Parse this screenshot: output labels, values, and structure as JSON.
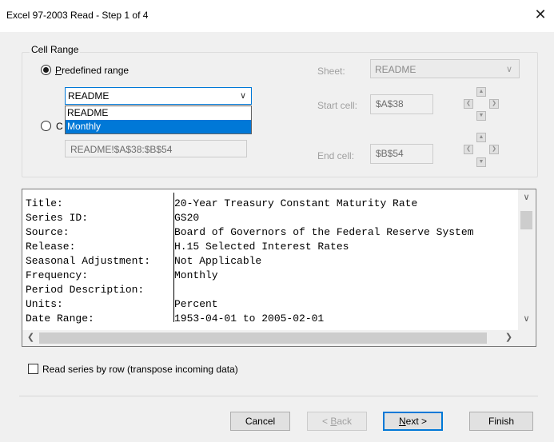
{
  "window": {
    "title": "Excel 97-2003 Read - Step 1 of 4",
    "close_glyph": "✕"
  },
  "cell_range": {
    "legend": "Cell Range",
    "predefined_label_prefix": "",
    "predefined_label_mnemonic": "P",
    "predefined_label_rest": "redefined range",
    "predefined_selected": "README",
    "dropdown_options": [
      "README",
      "Monthly"
    ],
    "custom_label_partial": "C",
    "custom_range_value": "README!$A$38:$B$54",
    "sheet_label": "Sheet:",
    "sheet_value": "README",
    "start_label": "Start cell:",
    "start_value": "$A$38",
    "end_label": "End cell:",
    "end_value": "$B$54"
  },
  "preview": {
    "rows": [
      {
        "key": "Title:",
        "value": "20-Year Treasury Constant Maturity Rate"
      },
      {
        "key": "Series ID:",
        "value": "GS20"
      },
      {
        "key": "Source:",
        "value": "Board of Governors of the Federal Reserve System"
      },
      {
        "key": "Release:",
        "value": "H.15 Selected Interest Rates"
      },
      {
        "key": "Seasonal Adjustment:",
        "value": "Not Applicable"
      },
      {
        "key": "Frequency:",
        "value": "Monthly"
      },
      {
        "key": "Period Description:",
        "value": ""
      },
      {
        "key": "Units:",
        "value": "Percent"
      },
      {
        "key": "Date Range:",
        "value": "1953-04-01 to 2005-02-01"
      }
    ]
  },
  "options": {
    "transpose_label": "Read series by row (transpose incoming data)",
    "transpose_checked": false
  },
  "buttons": {
    "cancel": "Cancel",
    "back_prefix": "< ",
    "back_mnemonic": "B",
    "back_rest": "ack",
    "next_mnemonic": "N",
    "next_rest": "ext >",
    "finish": "Finish"
  },
  "icons": {
    "chevron": "∨",
    "scroll_up": "▲",
    "scroll_down": "▼",
    "scroll_left": "❮",
    "scroll_right": "❯"
  }
}
